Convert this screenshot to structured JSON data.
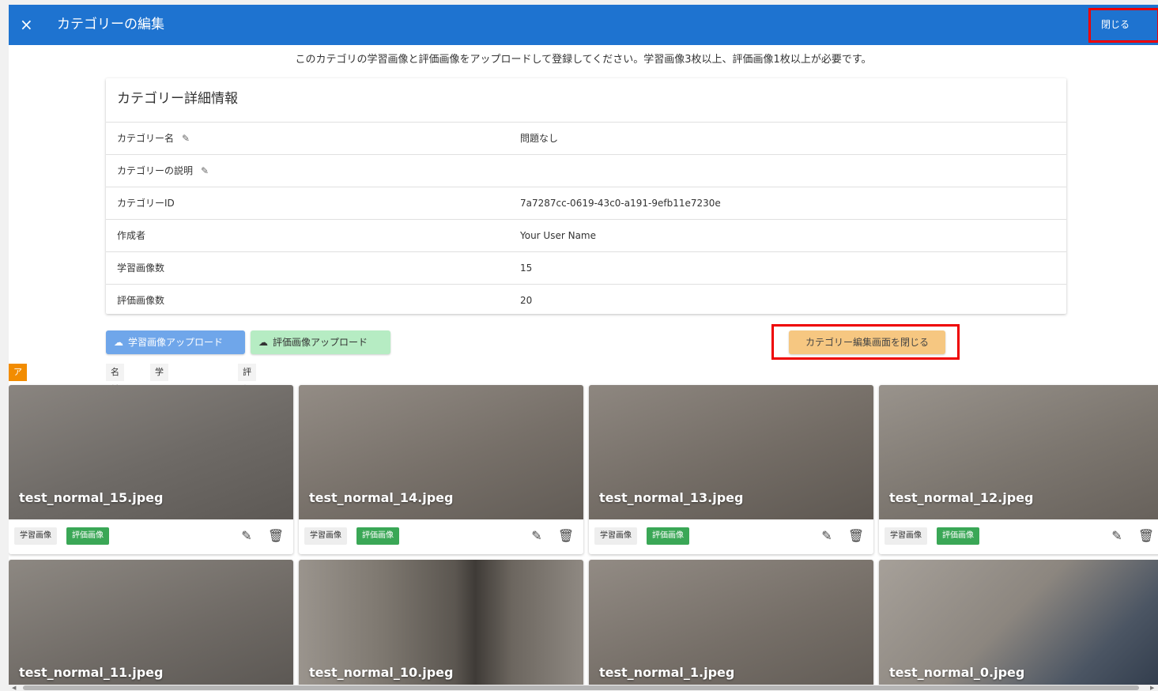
{
  "header": {
    "close_icon": "×",
    "title": "カテゴリーの編集",
    "close_label": "閉じる"
  },
  "instruction": "このカテゴリの学習画像と評価画像をアップロードして登録してください。学習画像3枚以上、評価画像1枚以上が必要です。",
  "details": {
    "title": "カテゴリー詳細情報",
    "rows": [
      {
        "label": "カテゴリー名",
        "value": "問題なし"
      },
      {
        "label": "カテゴリーの説明",
        "value": ""
      },
      {
        "label": "カテゴリーID",
        "value": "7a7287cc-0619-43c0-a191-9efb11e7230e"
      },
      {
        "label": "作成者",
        "value": "Your User Name"
      },
      {
        "label": "学習画像数",
        "value": "15"
      },
      {
        "label": "評価画像数",
        "value": "20"
      }
    ]
  },
  "buttons": {
    "upload_train": "学習画像アップロード",
    "upload_eval": "評価画像アップロード",
    "close_edit": "カテゴリー編集画面を閉じる"
  },
  "sort_options": [
    "アップロード日時順",
    "名前順",
    "学習画像のみ表示",
    "評価画像のみ表示"
  ],
  "tag_labels": {
    "train": "学習画像",
    "eval": "評価画像"
  },
  "images": [
    {
      "name": "test_normal_15.jpeg"
    },
    {
      "name": "test_normal_14.jpeg"
    },
    {
      "name": "test_normal_13.jpeg"
    },
    {
      "name": "test_normal_12.jpeg"
    },
    {
      "name": "test_normal_11.jpeg"
    },
    {
      "name": "test_normal_10.jpeg"
    },
    {
      "name": "test_normal_1.jpeg"
    },
    {
      "name": "test_normal_0.jpeg"
    }
  ],
  "icons": {
    "pencil": "pencil-icon",
    "trash": "trash-icon",
    "cloud_upload": "cloud-upload-icon"
  },
  "colors": {
    "appbar": "#1e73d0",
    "active_sort": "#f28c00",
    "eval_tag": "#3aa756",
    "train_button": "#6fa6ea",
    "eval_button": "#b6ecc3",
    "close_edit_button": "#f6c781",
    "highlight": "#e00000"
  }
}
